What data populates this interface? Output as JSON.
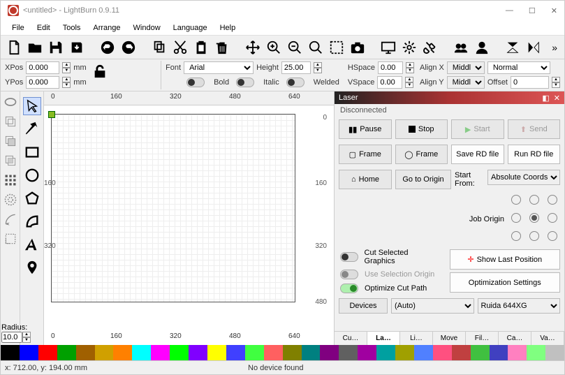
{
  "title": "<untitled> - LightBurn 0.9.11",
  "wmin": "—",
  "wmax": "☐",
  "wclose": "✕",
  "menu": [
    "File",
    "Edit",
    "Tools",
    "Arrange",
    "Window",
    "Language",
    "Help"
  ],
  "prop": {
    "xpos_label": "XPos",
    "xpos": "0.000",
    "ypos_label": "YPos",
    "ypos": "0.000",
    "mm": "mm",
    "font_label": "Font",
    "font": "Arial",
    "height_label": "Height",
    "height": "25.00",
    "hspace_label": "HSpace",
    "hspace": "0.00",
    "vspace_label": "VSpace",
    "vspace": "0.00",
    "alignx_label": "Align X",
    "alignx": "Middle",
    "aligny_label": "Align Y",
    "aligny": "Middle",
    "norm": "Normal",
    "offset_label": "Offset",
    "offset": "0",
    "bold": "Bold",
    "italic": "Italic",
    "welded": "Welded"
  },
  "laser": {
    "hdr": "Laser",
    "pop": "◧",
    "close": "✕",
    "status": "Disconnected",
    "pause": "Pause",
    "stop": "Stop",
    "start": "Start",
    "send": "Send",
    "frame1": "Frame",
    "frame2": "Frame",
    "saverd": "Save RD file",
    "runrd": "Run RD file",
    "home": "Home",
    "goto": "Go to Origin",
    "startfrom": "Start From:",
    "startsel": "Absolute Coords",
    "joborigin": "Job Origin",
    "cutsel": "Cut Selected Graphics",
    "useselorig": "Use Selection Origin",
    "optcut": "Optimize Cut Path",
    "showlast": "Show Last Position",
    "optset": "Optimization Settings",
    "devices": "Devices",
    "auto": "(Auto)",
    "dev": "Ruida 644XG"
  },
  "tabs": [
    "Cu…",
    "La…",
    "Li…",
    "Move",
    "Fil…",
    "Ca…",
    "Va…"
  ],
  "ticks": [
    "0",
    "160",
    "320",
    "480",
    "640"
  ],
  "vticks": [
    "160",
    "320"
  ],
  "vtickr": [
    "160",
    "320",
    "480"
  ],
  "radius_label": "Radius:",
  "radius": "10.0",
  "status": {
    "pos": "x: 712.00, y: 194.00 mm",
    "dev": "No device found"
  },
  "palette": [
    "#000",
    "#0000ff",
    "#ff0000",
    "#00a000",
    "#a06000",
    "#d0a000",
    "#ff8000",
    "#00ffff",
    "#ff00ff",
    "#00ff00",
    "#8000ff",
    "#ffff00",
    "#4040ff",
    "#40ff40",
    "#ff6060",
    "#808000",
    "#008080",
    "#800080",
    "#606060",
    "#a000a0",
    "#00a0a0",
    "#a0a000",
    "#5080ff",
    "#ff5080",
    "#c04040",
    "#40c040",
    "#4040c0",
    "#ff80c0",
    "#80ff80",
    "#c0c0c0"
  ]
}
